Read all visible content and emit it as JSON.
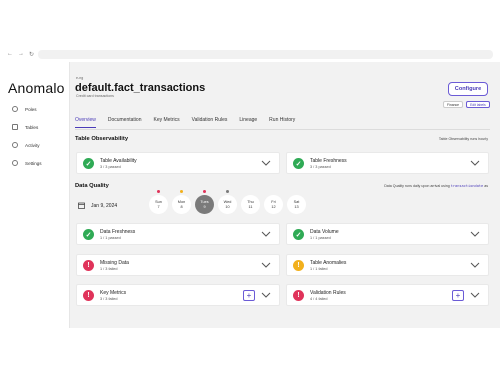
{
  "browser": {
    "nav_icons": [
      "back-icon",
      "forward-icon",
      "reload-icon"
    ],
    "nav_glyphs": [
      "←",
      "→",
      "↻"
    ]
  },
  "sidebar": {
    "logo": "Anomalo",
    "items": [
      {
        "label": "Poles",
        "icon": "home-icon"
      },
      {
        "label": "Tables",
        "icon": "table-icon"
      },
      {
        "label": "Activity",
        "icon": "activity-icon"
      },
      {
        "label": "Settings",
        "icon": "gear-icon"
      }
    ]
  },
  "header": {
    "env": "e-ng",
    "title": "default.fact_transactions",
    "subtitle": "Credit card transactions",
    "configure_label": "Configure",
    "tags": [
      "Finance",
      "Edit labels"
    ]
  },
  "tabs": [
    "Overview",
    "Documentation",
    "Key Metrics",
    "Validation Rules",
    "Lineage",
    "Run History"
  ],
  "active_tab": "Overview",
  "observability": {
    "title": "Table Observability",
    "note": "Table Observability runs hourly",
    "cards": [
      {
        "name": "Table Availability",
        "meta": "3 / 3 passed",
        "status": "ok"
      },
      {
        "name": "Table Freshness",
        "meta": "3 / 3 passed",
        "status": "ok"
      }
    ]
  },
  "data_quality": {
    "title": "Data Quality",
    "note_prefix": "Data Quality runs daily upon arrival using",
    "note_code": "transactiondate",
    "note_suffix": "as",
    "date": "Jan 9, 2024",
    "days": [
      {
        "dow": "Sun",
        "num": "7",
        "dot": "#e0335a",
        "selected": false
      },
      {
        "dow": "Mon",
        "num": "8",
        "dot": "#f2b01c",
        "selected": false
      },
      {
        "dow": "Tues",
        "num": "9",
        "dot": "#e0335a",
        "selected": true
      },
      {
        "dow": "Wed",
        "num": "10",
        "dot": "#7a7a7a",
        "selected": false
      },
      {
        "dow": "Thu",
        "num": "11",
        "dot": "",
        "selected": false
      },
      {
        "dow": "Fri",
        "num": "12",
        "dot": "",
        "selected": false
      },
      {
        "dow": "Sat",
        "num": "13",
        "dot": "",
        "selected": false
      }
    ],
    "cards": [
      {
        "name": "Data Freshness",
        "meta": "1 / 1 passed",
        "status": "ok",
        "plus": false
      },
      {
        "name": "Data Volume",
        "meta": "1 / 1 passed",
        "status": "ok",
        "plus": false
      },
      {
        "name": "Missing Data",
        "meta": "1 / 3 failed",
        "status": "err",
        "plus": false
      },
      {
        "name": "Table Anomalies",
        "meta": "1 / 1 failed",
        "status": "warn",
        "plus": false
      },
      {
        "name": "Key Metrics",
        "meta": "3 / 3 failed",
        "status": "err",
        "plus": true
      },
      {
        "name": "Validation Rules",
        "meta": "4 / 4 failed",
        "status": "err",
        "plus": true
      }
    ]
  },
  "colors": {
    "accent": "#4a3bb8",
    "ok": "#2faa55",
    "error": "#e0335a",
    "warn": "#f2b01c"
  }
}
